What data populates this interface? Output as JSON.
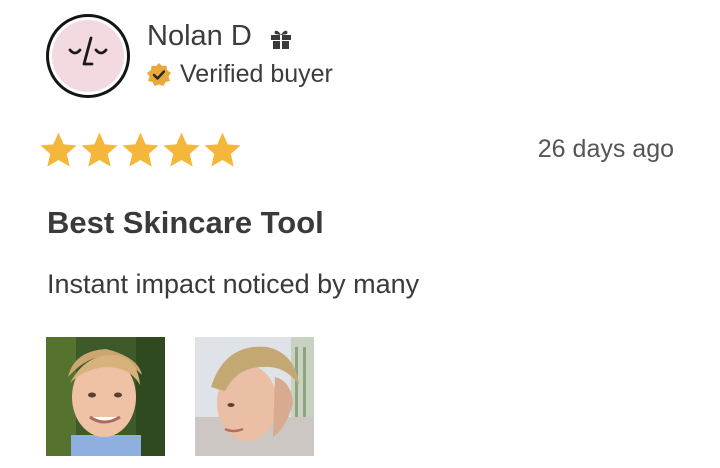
{
  "review": {
    "author_name": "Nolan D",
    "verified_label": "Verified buyer",
    "rating": 5,
    "rating_max": 5,
    "date": "26 days ago",
    "title": "Best Skincare Tool",
    "body": "Instant impact noticed by many"
  },
  "icons": {
    "avatar": "sleepy-face-icon",
    "gift": "gift-icon",
    "verified": "verified-badge-icon",
    "star": "star-icon"
  },
  "colors": {
    "star": "#F4B73A",
    "verified_badge": "#E9A93A",
    "avatar_bg": "#F3D9E0",
    "text": "#3A3A3A"
  }
}
